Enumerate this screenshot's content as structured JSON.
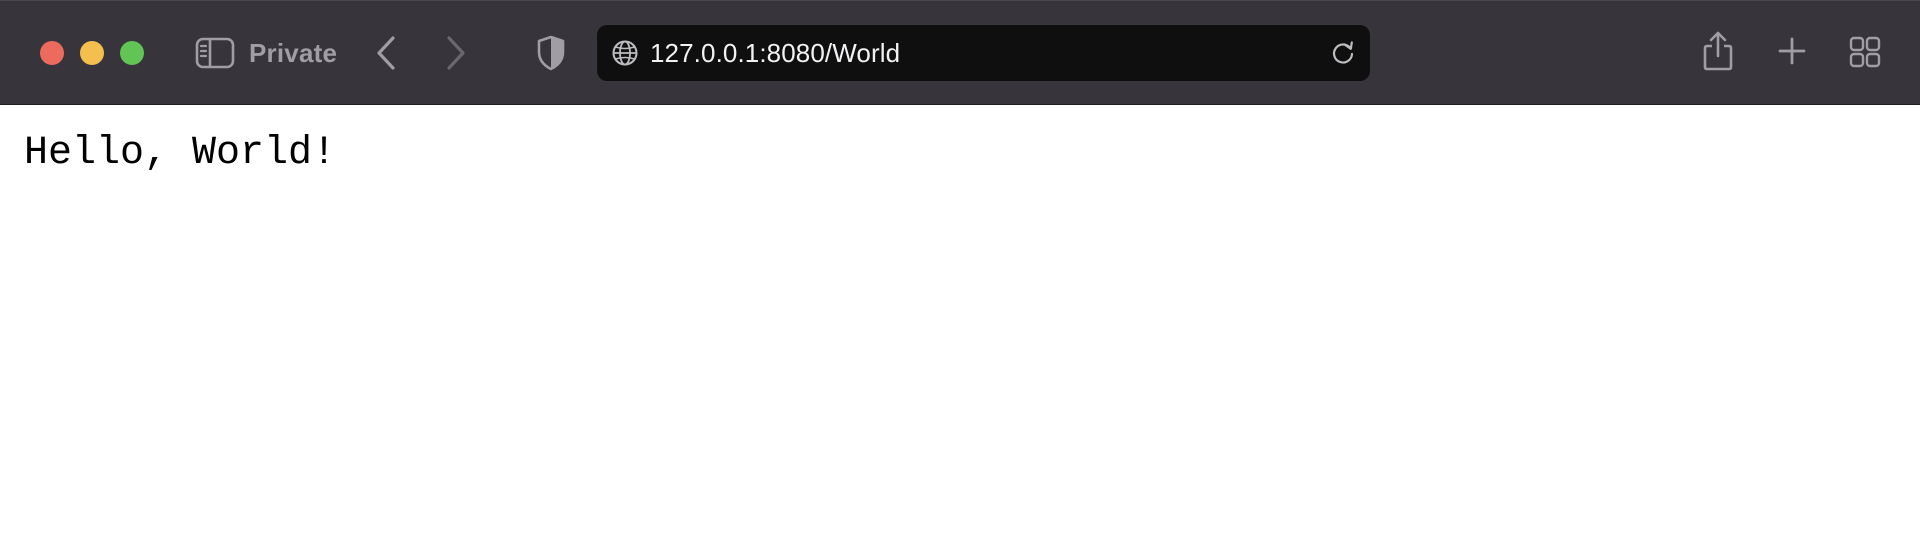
{
  "window": {
    "traffic_lights": {
      "close_color": "#ed6a5e",
      "minimize_color": "#f5bf4f",
      "maximize_color": "#61c454"
    }
  },
  "toolbar": {
    "background": "#37353b",
    "sidebar_icon": "sidebar-icon",
    "private_label": "Private",
    "back_icon": "chevron-left-icon",
    "forward_icon": "chevron-right-icon",
    "privacy_icon": "shield-icon",
    "address": {
      "globe_icon": "globe-icon",
      "url": "127.0.0.1:8080/World",
      "reload_icon": "reload-icon"
    },
    "share_icon": "share-icon",
    "new_tab_icon": "plus-icon",
    "tab_overview_icon": "tab-overview-icon"
  },
  "page": {
    "text": "Hello, World!"
  }
}
